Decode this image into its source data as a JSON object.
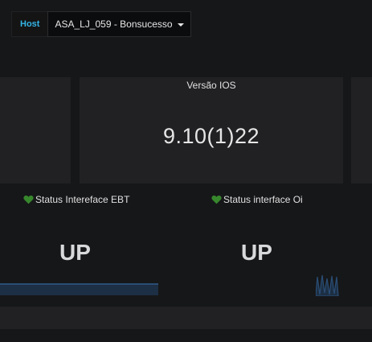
{
  "variables": {
    "host_label": "Host",
    "host_value": "ASA_LJ_059 - Bonsucesso"
  },
  "panels": {
    "ios": {
      "title": "Versão IOS",
      "value": "9.10(1)22"
    },
    "status_ebt": {
      "title": "Status Intereface EBT",
      "value": "UP"
    },
    "status_oi": {
      "title": "Status interface Oi",
      "value": "UP"
    }
  },
  "colors": {
    "accent": "#33b5e5",
    "heart": "#37872d",
    "spark": "#2a4d75"
  }
}
